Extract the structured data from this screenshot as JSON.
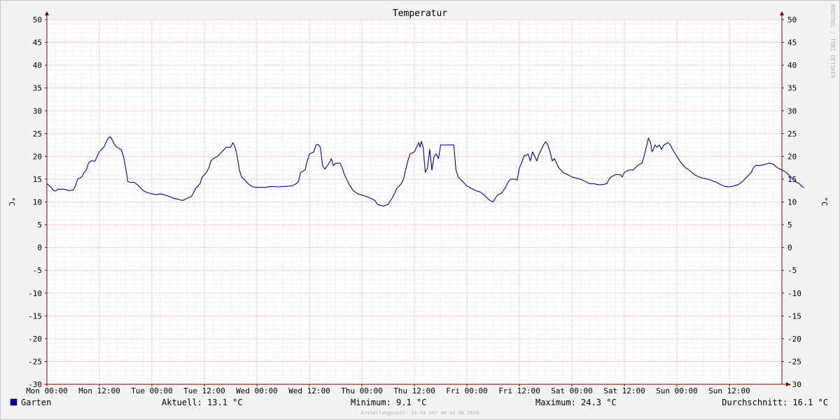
{
  "chart_data": {
    "type": "line",
    "title": "Temperatur",
    "ylabel": "°C",
    "ylabel_right": "°C",
    "watermark": "RRDTOOL / TOBI OETIKER",
    "ylim": [
      -30,
      50
    ],
    "yticks": [
      50,
      45,
      40,
      35,
      30,
      25,
      20,
      15,
      10,
      5,
      0,
      -5,
      -10,
      -15,
      -20,
      -25,
      -30
    ],
    "xlim": [
      0,
      168
    ],
    "xticks": [
      {
        "h": 0,
        "label": "Mon 00:00"
      },
      {
        "h": 12,
        "label": "Mon 12:00"
      },
      {
        "h": 24,
        "label": "Tue 00:00"
      },
      {
        "h": 36,
        "label": "Tue 12:00"
      },
      {
        "h": 48,
        "label": "Wed 00:00"
      },
      {
        "h": 60,
        "label": "Wed 12:00"
      },
      {
        "h": 72,
        "label": "Thu 00:00"
      },
      {
        "h": 84,
        "label": "Thu 12:00"
      },
      {
        "h": 96,
        "label": "Fri 00:00"
      },
      {
        "h": 108,
        "label": "Fri 12:00"
      },
      {
        "h": 120,
        "label": "Sat 00:00"
      },
      {
        "h": 132,
        "label": "Sat 12:00"
      },
      {
        "h": 144,
        "label": "Sun 00:00"
      },
      {
        "h": 156,
        "label": "Sun 12:00"
      }
    ],
    "grid": true,
    "series": [
      {
        "name": "Garten",
        "color": "#0000a0",
        "points": [
          [
            0,
            14.0
          ],
          [
            1,
            13.2
          ],
          [
            1.5,
            12.5
          ],
          [
            2,
            12.4
          ],
          [
            2.5,
            12.8
          ],
          [
            4,
            12.8
          ],
          [
            5,
            12.5
          ],
          [
            6,
            12.6
          ],
          [
            6.5,
            13.5
          ],
          [
            7,
            15.0
          ],
          [
            8,
            15.5
          ],
          [
            8.5,
            16.5
          ],
          [
            9,
            17.0
          ],
          [
            9.5,
            18.5
          ],
          [
            10,
            19.0
          ],
          [
            11,
            19.0
          ],
          [
            11.5,
            20.0
          ],
          [
            12,
            21.0
          ],
          [
            12.5,
            21.5
          ],
          [
            13,
            22.0
          ],
          [
            13.5,
            23.0
          ],
          [
            14,
            24.0
          ],
          [
            14.5,
            24.3
          ],
          [
            15,
            23.5
          ],
          [
            15.5,
            22.5
          ],
          [
            16,
            22.0
          ],
          [
            17,
            21.5
          ],
          [
            17.5,
            20.0
          ],
          [
            18,
            17.5
          ],
          [
            18.5,
            14.5
          ],
          [
            19,
            14.3
          ],
          [
            20,
            14.3
          ],
          [
            21,
            13.5
          ],
          [
            22,
            12.5
          ],
          [
            23,
            12.0
          ],
          [
            24,
            11.8
          ],
          [
            25,
            11.6
          ],
          [
            26,
            11.8
          ],
          [
            27,
            11.5
          ],
          [
            28,
            11.2
          ],
          [
            29,
            10.8
          ],
          [
            30,
            10.6
          ],
          [
            31,
            10.3
          ],
          [
            32,
            10.8
          ],
          [
            33,
            11.2
          ],
          [
            33.5,
            12.0
          ],
          [
            34,
            13.0
          ],
          [
            35,
            14.0
          ],
          [
            35.5,
            15.5
          ],
          [
            36,
            16.0
          ],
          [
            36.5,
            16.5
          ],
          [
            37,
            17.5
          ],
          [
            37.5,
            19.0
          ],
          [
            38,
            19.5
          ],
          [
            39,
            20.0
          ],
          [
            40,
            21.0
          ],
          [
            41,
            22.0
          ],
          [
            42,
            22.0
          ],
          [
            42.5,
            23.0
          ],
          [
            43,
            22.0
          ],
          [
            43.5,
            20.0
          ],
          [
            44,
            17.0
          ],
          [
            44.5,
            15.5
          ],
          [
            45,
            15.0
          ],
          [
            46,
            14.0
          ],
          [
            47,
            13.3
          ],
          [
            48,
            13.2
          ],
          [
            50,
            13.2
          ],
          [
            51,
            13.4
          ],
          [
            53,
            13.3
          ],
          [
            54,
            13.4
          ],
          [
            56,
            13.5
          ],
          [
            57,
            14.0
          ],
          [
            57.5,
            14.5
          ],
          [
            58,
            16.5
          ],
          [
            59,
            17.0
          ],
          [
            59.5,
            19.0
          ],
          [
            60,
            20.5
          ],
          [
            61,
            21.0
          ],
          [
            61.5,
            22.5
          ],
          [
            62,
            22.6
          ],
          [
            62.5,
            22.0
          ],
          [
            63,
            18.0
          ],
          [
            63.5,
            17.2
          ],
          [
            64,
            17.8
          ],
          [
            64.5,
            18.5
          ],
          [
            65,
            19.5
          ],
          [
            65.5,
            18.0
          ],
          [
            66,
            18.5
          ],
          [
            67,
            18.5
          ],
          [
            67.5,
            17.5
          ],
          [
            68,
            16.0
          ],
          [
            69,
            14.0
          ],
          [
            70,
            12.5
          ],
          [
            71,
            11.8
          ],
          [
            72,
            11.5
          ],
          [
            73,
            11.2
          ],
          [
            74,
            10.8
          ],
          [
            75,
            10.3
          ],
          [
            75.5,
            9.5
          ],
          [
            76,
            9.3
          ],
          [
            77,
            9.1
          ],
          [
            78,
            9.5
          ],
          [
            79,
            11.0
          ],
          [
            80,
            13.0
          ],
          [
            81,
            14.0
          ],
          [
            81.5,
            15.0
          ],
          [
            82,
            17.0
          ],
          [
            82.5,
            19.0
          ],
          [
            83,
            20.5
          ],
          [
            84,
            21.0
          ],
          [
            84.5,
            22.0
          ],
          [
            85,
            23.0
          ],
          [
            85.3,
            22.0
          ],
          [
            85.6,
            23.3
          ],
          [
            86,
            22.0
          ],
          [
            86.5,
            16.5
          ],
          [
            87,
            17.5
          ],
          [
            87.5,
            21.5
          ],
          [
            88,
            17.0
          ],
          [
            88.5,
            20.0
          ],
          [
            89,
            20.5
          ],
          [
            89.5,
            19.5
          ],
          [
            90,
            22.5
          ],
          [
            93,
            22.5
          ],
          [
            93.5,
            17.0
          ],
          [
            94,
            15.5
          ],
          [
            95,
            14.5
          ],
          [
            96,
            13.5
          ],
          [
            97,
            13.0
          ],
          [
            98,
            12.5
          ],
          [
            99,
            12.2
          ],
          [
            100,
            11.5
          ],
          [
            101,
            10.5
          ],
          [
            101.5,
            10.2
          ],
          [
            102,
            10.0
          ],
          [
            102.5,
            10.8
          ],
          [
            103,
            11.5
          ],
          [
            104,
            12.0
          ],
          [
            105,
            13.5
          ],
          [
            105.5,
            14.5
          ],
          [
            106,
            15.0
          ],
          [
            107,
            15.0
          ],
          [
            107.5,
            14.8
          ],
          [
            108,
            17.5
          ],
          [
            108.5,
            18.5
          ],
          [
            109,
            20.0
          ],
          [
            110,
            20.5
          ],
          [
            110.5,
            19.0
          ],
          [
            111,
            21.0
          ],
          [
            111.5,
            20.0
          ],
          [
            112,
            19.0
          ],
          [
            112.5,
            20.5
          ],
          [
            113,
            21.5
          ],
          [
            113.5,
            22.5
          ],
          [
            114,
            23.2
          ],
          [
            114.5,
            22.5
          ],
          [
            115,
            21.0
          ],
          [
            115.5,
            19.0
          ],
          [
            116,
            19.5
          ],
          [
            116.5,
            18.5
          ],
          [
            117,
            17.5
          ],
          [
            118,
            16.5
          ],
          [
            119,
            16.0
          ],
          [
            120,
            15.5
          ],
          [
            121,
            15.2
          ],
          [
            122,
            15.0
          ],
          [
            123,
            14.5
          ],
          [
            124,
            14.0
          ],
          [
            125,
            14.0
          ],
          [
            126,
            13.8
          ],
          [
            127,
            13.8
          ],
          [
            128,
            14.0
          ],
          [
            128.5,
            15.0
          ],
          [
            129,
            15.5
          ],
          [
            130,
            16.0
          ],
          [
            131,
            16.0
          ],
          [
            131.5,
            15.5
          ],
          [
            132,
            16.5
          ],
          [
            133,
            17.0
          ],
          [
            134,
            17.0
          ],
          [
            134.5,
            17.5
          ],
          [
            135,
            18.0
          ],
          [
            136,
            18.5
          ],
          [
            136.5,
            20.0
          ],
          [
            137,
            22.0
          ],
          [
            137.5,
            24.0
          ],
          [
            138,
            23.0
          ],
          [
            138.3,
            21.0
          ],
          [
            138.6,
            21.5
          ],
          [
            139,
            22.5
          ],
          [
            139.5,
            22.0
          ],
          [
            140,
            22.5
          ],
          [
            140.5,
            21.5
          ],
          [
            141,
            22.5
          ],
          [
            142,
            23.0
          ],
          [
            142.5,
            22.5
          ],
          [
            143,
            21.5
          ],
          [
            144,
            20.0
          ],
          [
            145,
            18.5
          ],
          [
            146,
            17.5
          ],
          [
            147,
            16.8
          ],
          [
            148,
            16.0
          ],
          [
            149,
            15.5
          ],
          [
            150,
            15.2
          ],
          [
            151,
            15.0
          ],
          [
            152,
            14.7
          ],
          [
            153,
            14.3
          ],
          [
            154,
            13.8
          ],
          [
            155,
            13.4
          ],
          [
            156,
            13.3
          ],
          [
            157,
            13.5
          ],
          [
            158,
            13.8
          ],
          [
            159,
            14.5
          ],
          [
            160,
            15.5
          ],
          [
            161,
            16.5
          ],
          [
            161.5,
            17.5
          ],
          [
            162,
            18.0
          ],
          [
            163,
            18.0
          ],
          [
            164,
            18.2
          ],
          [
            165,
            18.5
          ],
          [
            166,
            18.3
          ],
          [
            167,
            17.5
          ],
          [
            168,
            17.0
          ],
          [
            169,
            16.5
          ],
          [
            170,
            15.5
          ],
          [
            171,
            14.5
          ],
          [
            172,
            14.0
          ],
          [
            172.5,
            13.5
          ],
          [
            173,
            13.1
          ]
        ]
      }
    ],
    "legend": {
      "name": "Garten",
      "current": "Aktuell: 13.1 °C",
      "minimum": "Minimum: 9.1 °C",
      "maximum": "Maximum: 24.3 °C",
      "average": "Durchschnitt: 16.1 °C"
    },
    "footer": "Erstellungszeit: 23:58 Uhr am 02.06.2024"
  },
  "colors": {
    "background": "#f3f3f3",
    "plot": "#ffffff",
    "grid_minor": "#dcdcdc",
    "grid_major": "#e8a0a0",
    "axis": "#800000",
    "line": "#0000a0",
    "legend_swatch": "#0000a0",
    "watermark": "#b4b4b4",
    "footer": "#b4b4b4"
  }
}
